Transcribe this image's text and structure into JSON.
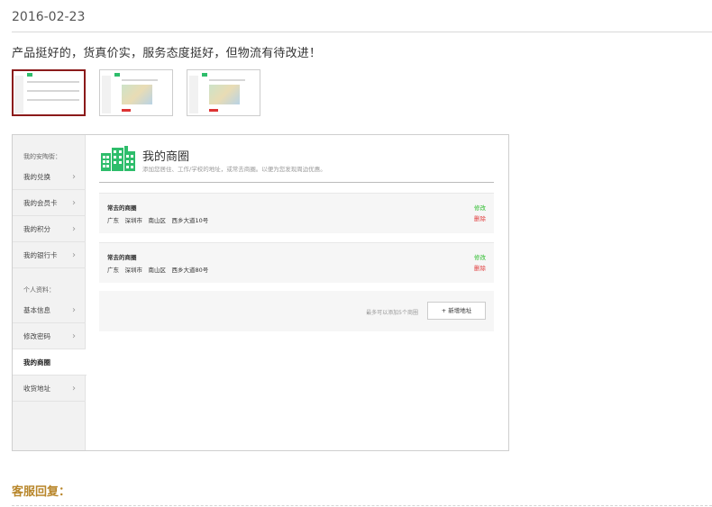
{
  "review": {
    "date": "2016-02-23",
    "text": "产品挺好的，货真价实，服务态度挺好，但物流有待改进！",
    "thumbnails": [
      "thumbnail-1",
      "thumbnail-2",
      "thumbnail-3"
    ]
  },
  "screenshot": {
    "sidebar": {
      "section1_label": "我的安陶街：",
      "section1_items": [
        "我的兑换",
        "我的会员卡",
        "我的积分",
        "我的银行卡"
      ],
      "section2_label": "个人资料：",
      "section2_items": [
        "基本信息",
        "修改密码",
        "我的商圈",
        "收货地址"
      ],
      "active_item": "我的商圈"
    },
    "main": {
      "icon": "building-icon",
      "title": "我的商圈",
      "subtitle": "添加您居住、工作/学校的地址，或常去商圈。以便为您发现周边优惠。",
      "cards": [
        {
          "title": "常去的商圈",
          "address": "广东　深圳市　南山区　西乡大道10号",
          "edit": "修改",
          "delete": "删除"
        },
        {
          "title": "常去的商圈",
          "address": "广东　深圳市　南山区　西乡大道80号",
          "edit": "修改",
          "delete": "删除"
        }
      ],
      "add_hint": "最多可以添加5个商圈",
      "add_button": "+ 新增地址"
    },
    "colors": {
      "brand_green": "#2ebd6b",
      "edit_green": "#2ebd2e",
      "delete_red": "#e03b3b"
    }
  },
  "reply_label": "客服回复："
}
